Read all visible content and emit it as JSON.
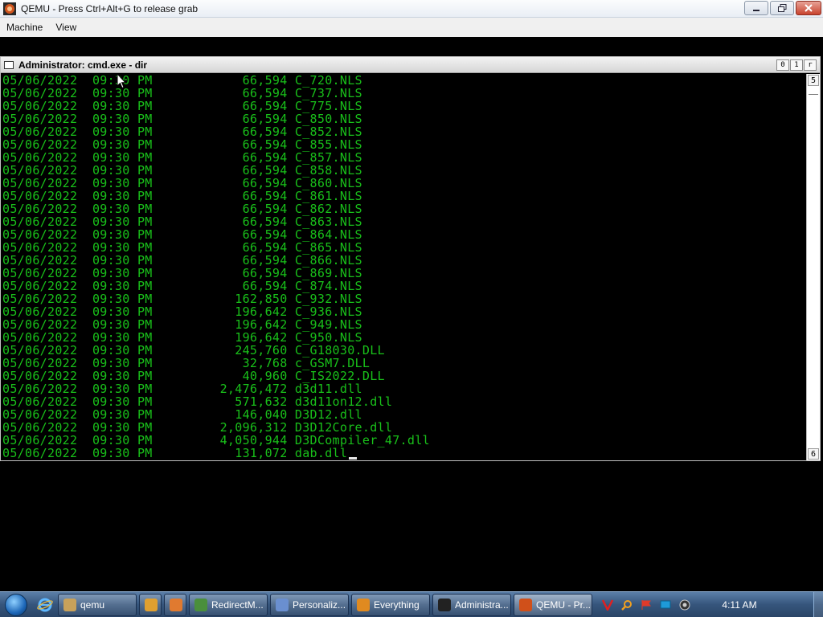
{
  "qemu": {
    "title": "QEMU - Press Ctrl+Alt+G to release grab",
    "menu": [
      "Machine",
      "View"
    ]
  },
  "console": {
    "title": "Administrator: cmd.exe - dir",
    "window_buttons": [
      "0",
      "1",
      "r"
    ],
    "scroll_markers": {
      "top": "5",
      "bottom": "6"
    },
    "lines": [
      "05/06/2022  09:30 PM            66,594 C_720.NLS",
      "05/06/2022  09:30 PM            66,594 C_737.NLS",
      "05/06/2022  09:30 PM            66,594 C_775.NLS",
      "05/06/2022  09:30 PM            66,594 C_850.NLS",
      "05/06/2022  09:30 PM            66,594 C_852.NLS",
      "05/06/2022  09:30 PM            66,594 C_855.NLS",
      "05/06/2022  09:30 PM            66,594 C_857.NLS",
      "05/06/2022  09:30 PM            66,594 C_858.NLS",
      "05/06/2022  09:30 PM            66,594 C_860.NLS",
      "05/06/2022  09:30 PM            66,594 C_861.NLS",
      "05/06/2022  09:30 PM            66,594 C_862.NLS",
      "05/06/2022  09:30 PM            66,594 C_863.NLS",
      "05/06/2022  09:30 PM            66,594 C_864.NLS",
      "05/06/2022  09:30 PM            66,594 C_865.NLS",
      "05/06/2022  09:30 PM            66,594 C_866.NLS",
      "05/06/2022  09:30 PM            66,594 C_869.NLS",
      "05/06/2022  09:30 PM            66,594 C_874.NLS",
      "05/06/2022  09:30 PM           162,850 C_932.NLS",
      "05/06/2022  09:30 PM           196,642 C_936.NLS",
      "05/06/2022  09:30 PM           196,642 C_949.NLS",
      "05/06/2022  09:30 PM           196,642 C_950.NLS",
      "05/06/2022  09:30 PM           245,760 C_G18030.DLL",
      "05/06/2022  09:30 PM            32,768 c_GSM7.DLL",
      "05/06/2022  09:30 PM            40,960 C_IS2022.DLL",
      "05/06/2022  09:30 PM         2,476,472 d3d11.dll",
      "05/06/2022  09:30 PM           571,632 d3d11on12.dll",
      "05/06/2022  09:30 PM           146,040 D3D12.dll",
      "05/06/2022  09:30 PM         2,096,312 D3D12Core.dll",
      "05/06/2022  09:30 PM         4,050,944 D3DCompiler_47.dll",
      "05/06/2022  09:30 PM           131,072 dab.dll"
    ]
  },
  "taskbar": {
    "buttons": [
      {
        "label": "qemu",
        "icon": "folder-icon",
        "color": "#c8a15a",
        "width": 98,
        "active": false
      },
      {
        "label": "",
        "icon": "media-player-icon",
        "color": "#e0a030",
        "width": 28,
        "active": false
      },
      {
        "label": "",
        "icon": "puzzle-icon",
        "color": "#e07a30",
        "width": 28,
        "active": false
      },
      {
        "label": "RedirectM...",
        "icon": "chrome-icon",
        "color": "#4a8f3c",
        "width": 98,
        "active": false
      },
      {
        "label": "Personaliz...",
        "icon": "notepad-icon",
        "color": "#6a8fd0",
        "width": 98,
        "active": false
      },
      {
        "label": "Everything",
        "icon": "magnifier-icon",
        "color": "#e08a20",
        "width": 98,
        "active": false
      },
      {
        "label": "Administra...",
        "icon": "cmd-icon",
        "color": "#222222",
        "width": 98,
        "active": false
      },
      {
        "label": "QEMU - Pr...",
        "icon": "qemu-icon",
        "color": "#d0501a",
        "width": 98,
        "active": true
      }
    ],
    "clock": "4:11 AM"
  }
}
